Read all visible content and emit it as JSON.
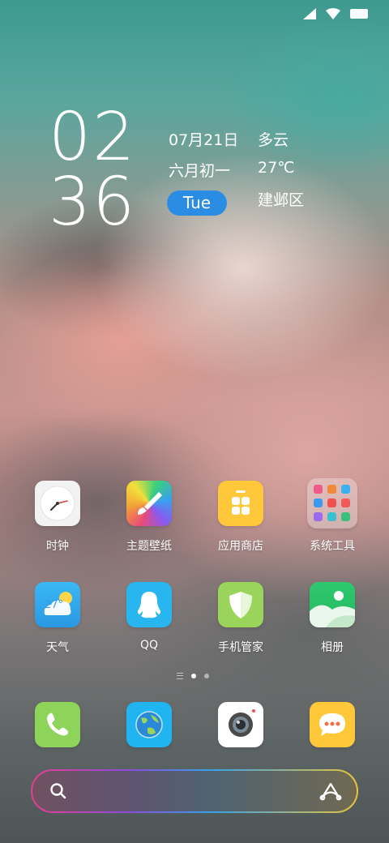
{
  "status_bar": {
    "icons": [
      "signal-icon",
      "wifi-icon",
      "battery-icon"
    ]
  },
  "clock": {
    "hours": "02",
    "minutes": "36"
  },
  "widget": {
    "date": "07月21日",
    "lunar": "六月初一",
    "weekday": "Tue",
    "weather": "多云",
    "temperature": "27℃",
    "location": "建邺区"
  },
  "apps": [
    {
      "label": "时钟",
      "icon": "clock-icon"
    },
    {
      "label": "主题壁纸",
      "icon": "theme-brush-icon"
    },
    {
      "label": "应用商店",
      "icon": "app-store-icon"
    },
    {
      "label": "系统工具",
      "icon": "folder-icon"
    },
    {
      "label": "天气",
      "icon": "weather-icon",
      "badge": "27°"
    },
    {
      "label": "QQ",
      "icon": "qq-icon"
    },
    {
      "label": "手机管家",
      "icon": "shield-icon"
    },
    {
      "label": "相册",
      "icon": "gallery-icon"
    }
  ],
  "page_indicator": {
    "pages": 2,
    "current": 1
  },
  "dock": [
    {
      "icon": "phone-icon"
    },
    {
      "icon": "browser-globe-icon"
    },
    {
      "icon": "camera-icon"
    },
    {
      "icon": "messages-icon"
    }
  ],
  "search": {
    "icons": [
      "search-icon",
      "assistant-icon"
    ]
  },
  "colors": {
    "accent_blue": "#2b8ce3",
    "clock_icon_bg": "#f2f2f2",
    "store_yellow": "#ffc83a",
    "weather_blue": "#3ab4f2",
    "qq_blue": "#29b5f0",
    "shield_green": "#9ad45a",
    "gallery_green": "#2ec86e",
    "phone_green": "#8fd45a",
    "messages_yellow": "#ffc83a"
  }
}
